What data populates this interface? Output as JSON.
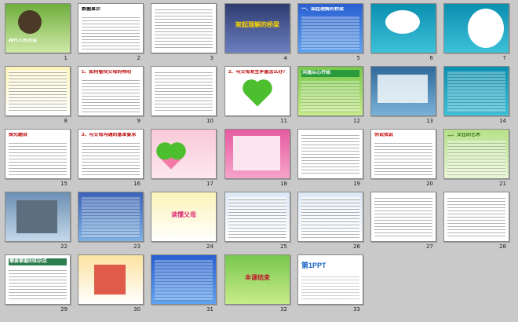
{
  "slides": [
    {
      "n": "1",
      "title": "两代人的对话"
    },
    {
      "n": "2",
      "title": "数据显示"
    },
    {
      "n": "3",
      "title": ""
    },
    {
      "n": "4",
      "title": "架起理解的桥梁"
    },
    {
      "n": "5",
      "title": "一、架起理解的桥梁"
    },
    {
      "n": "6",
      "title": ""
    },
    {
      "n": "7",
      "title": ""
    },
    {
      "n": "8",
      "title": ""
    },
    {
      "n": "9",
      "title": "1、如何看待父母的唠叨"
    },
    {
      "n": "10",
      "title": ""
    },
    {
      "n": "11",
      "title": "2、与父母发生矛盾怎么办？"
    },
    {
      "n": "12",
      "title": "沟通从心开始"
    },
    {
      "n": "13",
      "title": ""
    },
    {
      "n": "14",
      "title": ""
    },
    {
      "n": "15",
      "title": "探究题目"
    },
    {
      "n": "16",
      "title": "3、与父母沟通的基本要求"
    },
    {
      "n": "17",
      "title": ""
    },
    {
      "n": "18",
      "title": ""
    },
    {
      "n": "19",
      "title": ""
    },
    {
      "n": "20",
      "title": "你说我说"
    },
    {
      "n": "21",
      "title": "二、交往的艺术"
    },
    {
      "n": "22",
      "title": ""
    },
    {
      "n": "23",
      "title": ""
    },
    {
      "n": "24",
      "title": "读懂父母"
    },
    {
      "n": "25",
      "title": ""
    },
    {
      "n": "26",
      "title": ""
    },
    {
      "n": "27",
      "title": ""
    },
    {
      "n": "28",
      "title": ""
    },
    {
      "n": "29",
      "title": "需要掌握的知识点"
    },
    {
      "n": "30",
      "title": ""
    },
    {
      "n": "31",
      "title": ""
    },
    {
      "n": "32",
      "title": "本课结束"
    },
    {
      "n": "33",
      "title": "第1PPT"
    }
  ]
}
